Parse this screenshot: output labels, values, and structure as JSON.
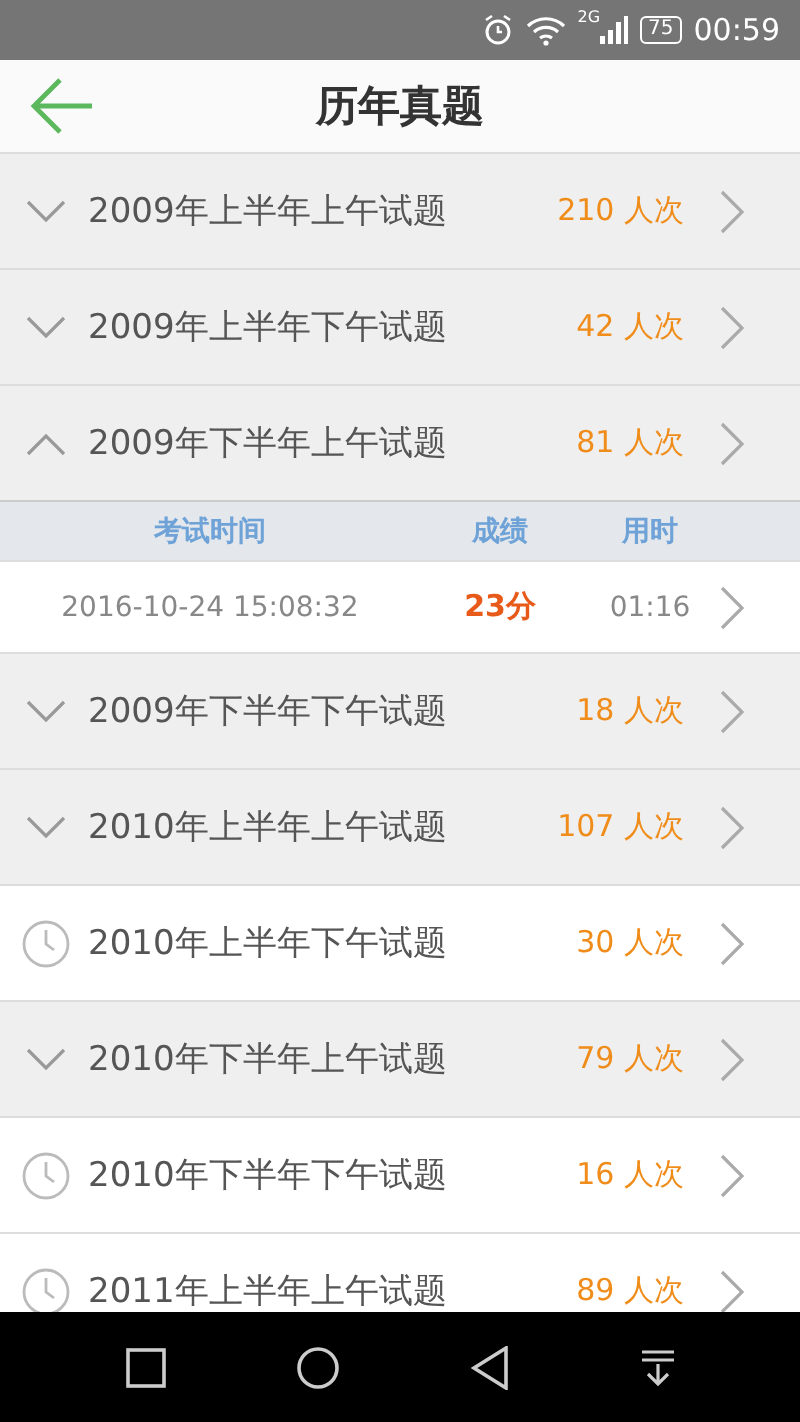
{
  "status_bar": {
    "network": "2G",
    "battery": "75",
    "time": "00:59"
  },
  "header": {
    "title": "历年真题"
  },
  "rows": [
    {
      "kind": "group",
      "expanded": false,
      "title": "2009年上半年上午试题",
      "count": "210 人次"
    },
    {
      "kind": "group",
      "expanded": false,
      "title": "2009年上半年下午试题",
      "count": "42 人次"
    },
    {
      "kind": "group",
      "expanded": true,
      "title": "2009年下半年上午试题",
      "count": "81 人次",
      "columns": [
        "考试时间",
        "成绩",
        "用时"
      ],
      "records": [
        {
          "time": "2016-10-24 15:08:32",
          "score": "23分",
          "duration": "01:16"
        }
      ]
    },
    {
      "kind": "group",
      "expanded": false,
      "title": "2009年下半年下午试题",
      "count": "18 人次"
    },
    {
      "kind": "group",
      "expanded": false,
      "title": "2010年上半年上午试题",
      "count": "107 人次"
    },
    {
      "kind": "paper",
      "title": "2010年上半年下午试题",
      "count": "30 人次"
    },
    {
      "kind": "group",
      "expanded": false,
      "title": "2010年下半年上午试题",
      "count": "79 人次"
    },
    {
      "kind": "paper",
      "title": "2010年下半年下午试题",
      "count": "16 人次"
    },
    {
      "kind": "paper",
      "title": "2011年上半年上午试题",
      "count": "89 人次"
    }
  ]
}
